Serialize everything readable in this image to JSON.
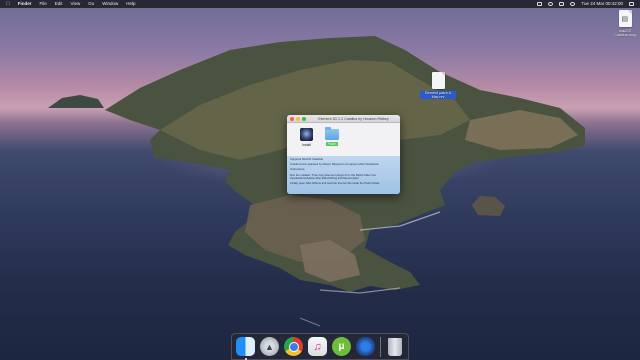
{
  "menubar": {
    "apple_icon": "apple-icon",
    "app_name": "Finder",
    "menus": [
      "File",
      "Edit",
      "View",
      "Go",
      "Window",
      "Help"
    ],
    "clock": "Tue 24 Mar  00:42:00"
  },
  "desktop": {
    "top_file_label": "macOS Catalina.dmg",
    "mid_file_label": "Element patch & Mac rev"
  },
  "window": {
    "title": "Element 3D 2.2 Catalina by Houston Ribbey",
    "items": [
      {
        "label": "Install",
        "icon": "app-icon"
      },
      {
        "label": "Patch",
        "icon": "folder-icon"
      }
    ],
    "instructions": [
      "Supports MacOS Catalina!",
      "Cracked and repacked by Mason Ripperson at support.effect.headdown",
      "Instructions:",
      "Run the installer. Then copy Element plugin from the Patch folder into /Applications/Adobe After Effects/Plug-ins/VideoCopilot/.",
      "Finally open After Effects and load the license file inside the Patch folder."
    ]
  },
  "dock": {
    "apps": [
      "Finder",
      "Launchpad",
      "Google Chrome",
      "iTunes",
      "uTorrent",
      "Network"
    ],
    "trash": "Trash"
  },
  "colors": {
    "menubar_bg": "#141419",
    "selection": "#2a5bd0",
    "patch_highlight": "#4fc44f"
  }
}
